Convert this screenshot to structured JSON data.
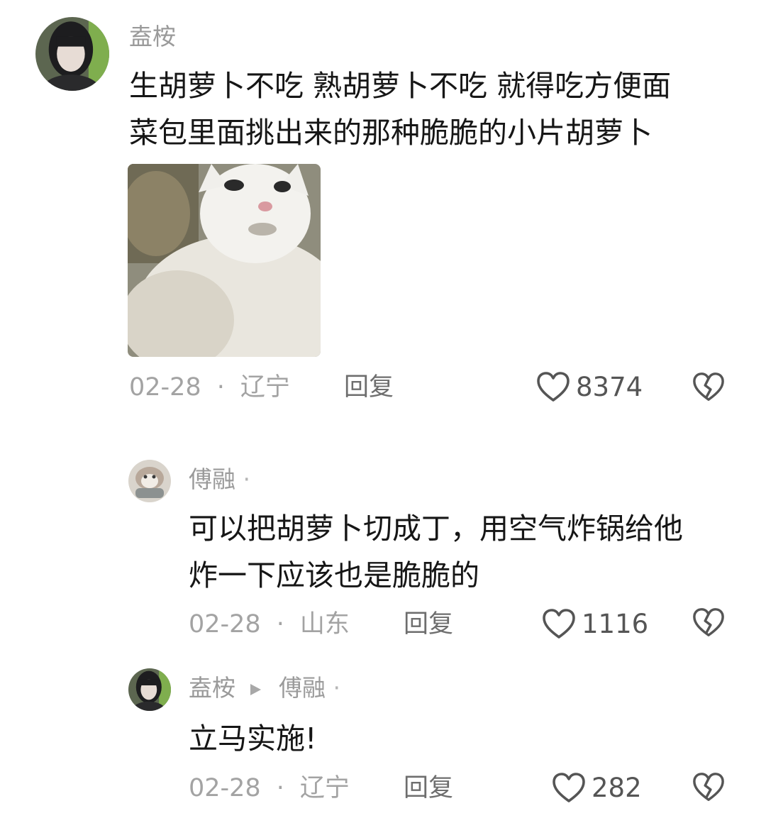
{
  "colors": {
    "text": "#161616",
    "muted": "#a3a3a3",
    "icon": "#555555"
  },
  "comments": [
    {
      "username": "盍桉",
      "text_lines": [
        "生胡萝卜不吃 熟胡萝卜不吃 就得吃方便面",
        "菜包里面挑出来的那种脆脆的小片胡萝卜"
      ],
      "date": "02-28",
      "location": "辽宁",
      "reply_label": "回复",
      "likes": "8374",
      "icons": {
        "like": "heart-outline-icon",
        "dislike": "broken-heart-icon"
      }
    },
    {
      "username": "傅融",
      "text_lines": [
        "可以把胡萝卜切成丁，用空气炸锅给他",
        "炸一下应该也是脆脆的"
      ],
      "date": "02-28",
      "location": "山东",
      "reply_label": "回复",
      "likes": "1116",
      "icons": {
        "like": "heart-outline-icon",
        "dislike": "broken-heart-icon"
      }
    },
    {
      "username": "盍桉",
      "reply_to": "傅融",
      "text_lines": [
        "立马实施!"
      ],
      "date": "02-28",
      "location": "辽宁",
      "reply_label": "回复",
      "likes": "282",
      "icons": {
        "like": "heart-outline-icon",
        "dislike": "broken-heart-icon",
        "reply_arrow": "play-triangle-icon"
      }
    }
  ]
}
